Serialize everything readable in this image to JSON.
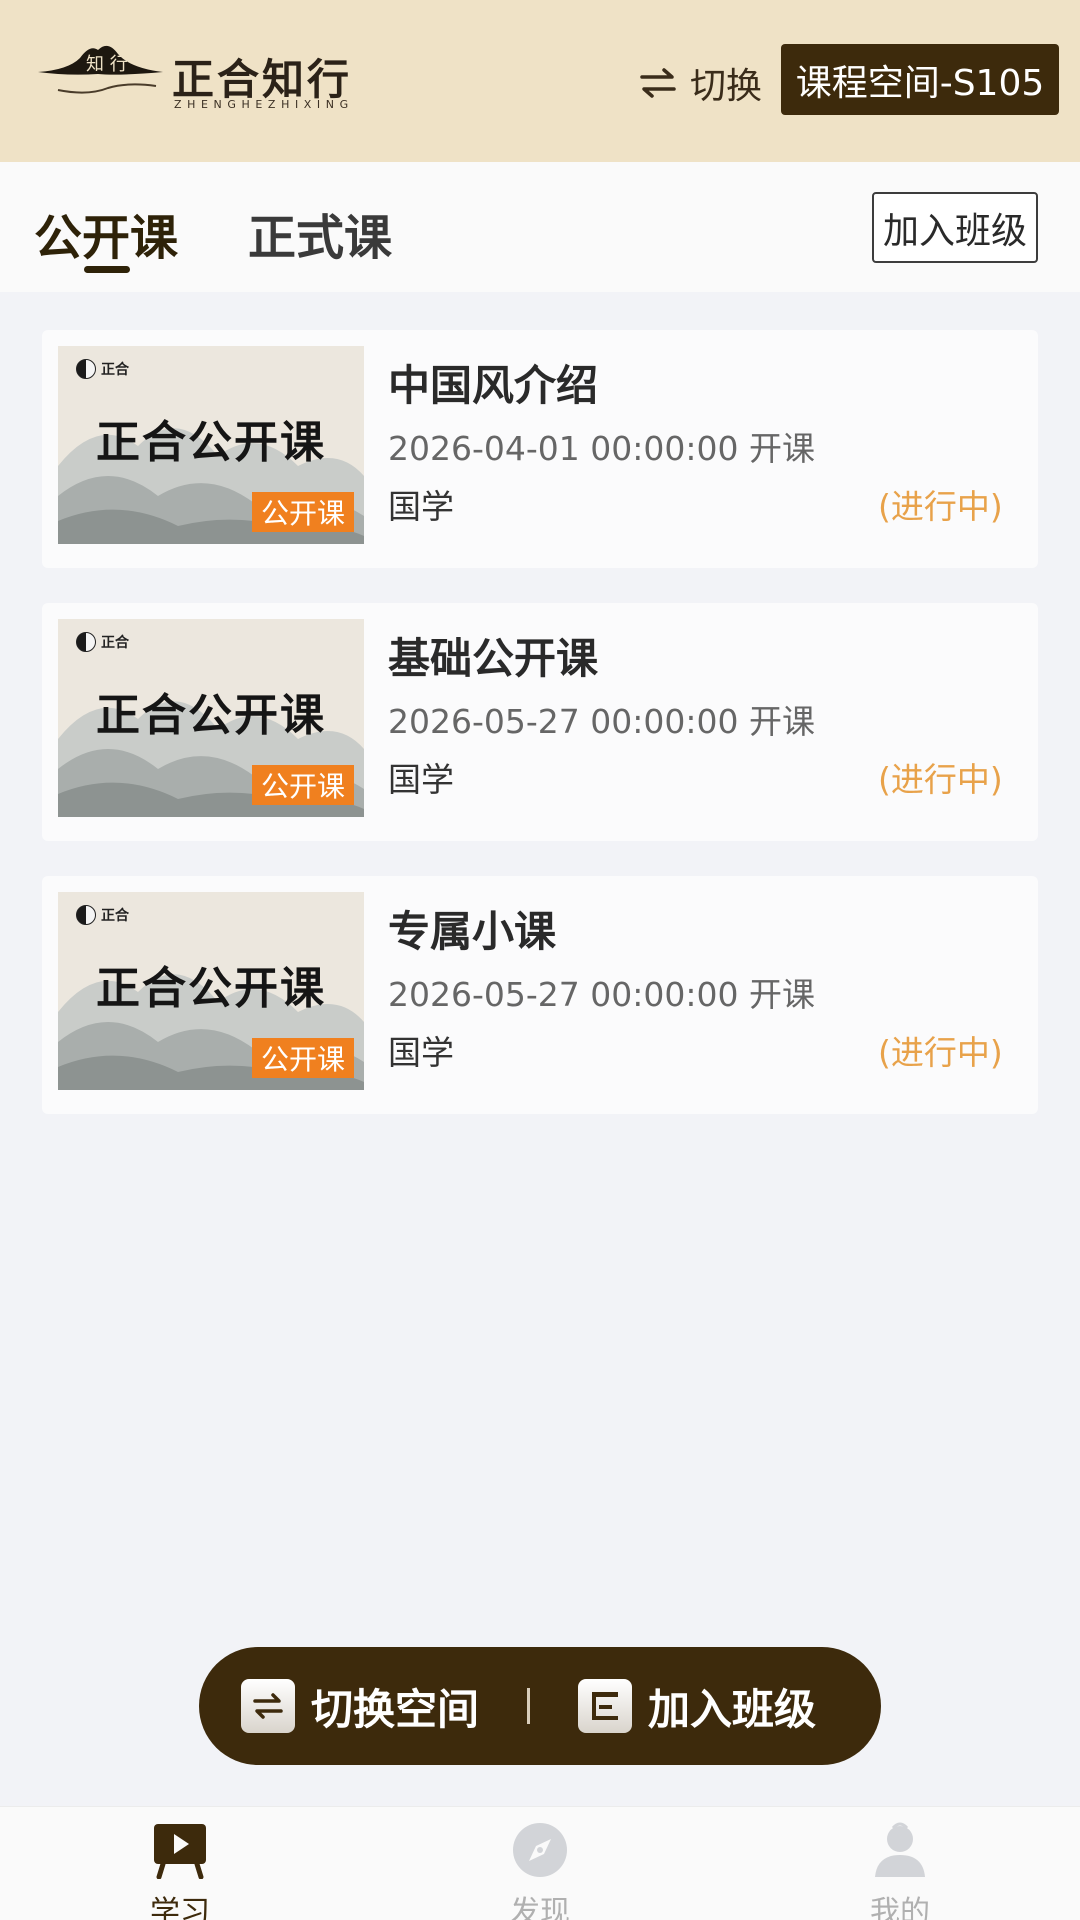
{
  "header": {
    "logo_title": "正合知行",
    "logo_subtitle": "ZHENGHEZHIXING",
    "logo_mark_chars": "知 行",
    "switch_label": "切换",
    "space_name": "课程空间-S105"
  },
  "tabs": [
    {
      "label": "公开课",
      "active": true
    },
    {
      "label": "正式课",
      "active": false
    }
  ],
  "join_class_label": "加入班级",
  "courses": [
    {
      "name": "中国风介绍",
      "date": "2026-04-01 00:00:00 开课",
      "category": "国学",
      "status": "(进行中)",
      "thumb_brand": "正合",
      "thumb_title": "正合公开课",
      "thumb_tag": "公开课"
    },
    {
      "name": "基础公开课",
      "date": "2026-05-27 00:00:00 开课",
      "category": "国学",
      "status": "(进行中)",
      "thumb_brand": "正合",
      "thumb_title": "正合公开课",
      "thumb_tag": "公开课"
    },
    {
      "name": "专属小课",
      "date": "2026-05-27 00:00:00 开课",
      "category": "国学",
      "status": "(进行中)",
      "thumb_brand": "正合",
      "thumb_title": "正合公开课",
      "thumb_tag": "公开课"
    }
  ],
  "float_bar": {
    "switch_space_label": "切换空间",
    "join_class_label": "加入班级"
  },
  "bottom_nav": [
    {
      "label": "学习",
      "icon": "play-board-icon",
      "active": true
    },
    {
      "label": "发现",
      "icon": "compass-icon",
      "active": false
    },
    {
      "label": "我的",
      "icon": "profile-icon",
      "active": false
    }
  ],
  "colors": {
    "header_bg": "#efe2c6",
    "brand_dark": "#3d2a0c",
    "status_orange": "#e8a24a",
    "tag_orange": "#f0801f"
  }
}
